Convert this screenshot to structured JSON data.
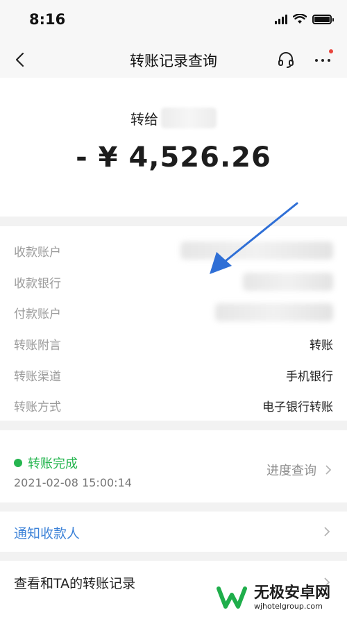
{
  "status_bar": {
    "time": "8:16"
  },
  "nav": {
    "title": "转账记录查询"
  },
  "transfer": {
    "payee_prefix": "转给",
    "amount": "- ¥ 4,526.26"
  },
  "details": [
    {
      "label": "收款账户",
      "value": ""
    },
    {
      "label": "收款银行",
      "value": ""
    },
    {
      "label": "付款账户",
      "value": ""
    },
    {
      "label": "转账附言",
      "value": "转账"
    },
    {
      "label": "转账渠道",
      "value": "手机银行"
    },
    {
      "label": "转账方式",
      "value": "电子银行转账"
    }
  ],
  "status": {
    "text": "转账完成",
    "time": "2021-02-08 15:00:14",
    "progress_label": "进度查询"
  },
  "notify": {
    "label": "通知收款人"
  },
  "history": {
    "label": "查看和TA的转账记录"
  },
  "watermark": {
    "title": "无极安卓网",
    "url": "wjhotelgroup.com"
  },
  "colors": {
    "success": "#25b54f",
    "link": "#3e83d8",
    "annotation_arrow": "#2f6fd6",
    "badge": "#e8453c"
  }
}
